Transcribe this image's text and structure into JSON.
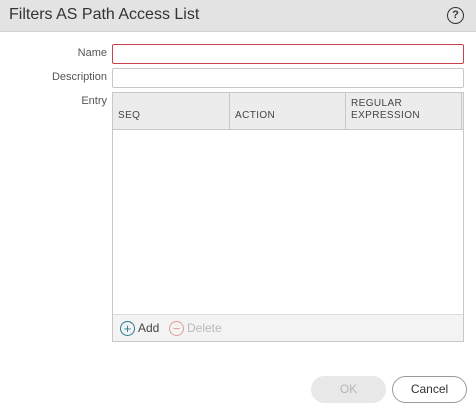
{
  "dialog": {
    "title": "Filters AS Path Access List",
    "help_icon": "question-circle-icon",
    "help_glyph": "?"
  },
  "form": {
    "name_label": "Name",
    "name_value": "",
    "description_label": "Description",
    "description_value": "",
    "entry_label": "Entry"
  },
  "grid": {
    "columns": [
      {
        "line1": "",
        "line2": "SEQ"
      },
      {
        "line1": "",
        "line2": "ACTION"
      },
      {
        "line1": "REGULAR",
        "line2": "EXPRESSION"
      }
    ],
    "rows": []
  },
  "footer": {
    "add_label": "Add",
    "add_icon": "plus-circle-icon",
    "add_glyph": "+",
    "delete_label": "Delete",
    "delete_icon": "minus-circle-icon",
    "delete_glyph": "−"
  },
  "buttons": {
    "ok_label": "OK",
    "cancel_label": "Cancel"
  },
  "colors": {
    "invalid_border": "#c8414b",
    "add_icon": "#2a7d95",
    "delete_icon": "#e39a9a"
  }
}
